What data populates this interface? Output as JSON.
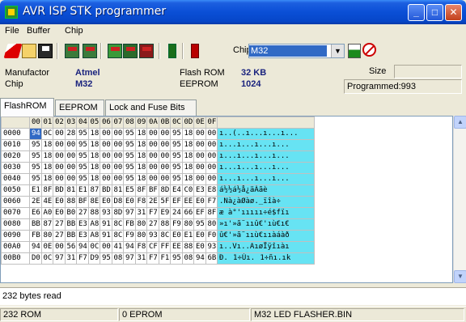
{
  "window": {
    "title": "AVR ISP STK programmer"
  },
  "menu": {
    "items": [
      "File",
      "Buffer",
      "Chip"
    ]
  },
  "toolbar": {
    "chip_label": "Chip",
    "chip_value": "M32",
    "icons": [
      "erase-icon",
      "open-icon",
      "save-icon",
      "read-chip-icon",
      "write-chip-icon",
      "verify-icon",
      "device-icon",
      "lock-icon",
      "run-icon",
      "stop-icon",
      "program-icon",
      "abort-icon"
    ]
  },
  "info": {
    "manufacturer_label": "Manufactor",
    "manufacturer_value": "Atmel",
    "chip_label": "Chip",
    "chip_value": "M32",
    "flash_label": "Flash ROM",
    "flash_value": "32 KB",
    "eeprom_label": "EEPROM",
    "eeprom_value": "1024",
    "size_label": "Size",
    "size_value": "",
    "status_text": "Programmed:993"
  },
  "tabs": [
    {
      "label": "FlashROM",
      "active": true
    },
    {
      "label": "EEPROM",
      "active": false
    },
    {
      "label": "Lock and Fuse Bits",
      "active": false
    }
  ],
  "hex": {
    "columns": [
      "00",
      "01",
      "02",
      "03",
      "04",
      "05",
      "06",
      "07",
      "08",
      "09",
      "0A",
      "0B",
      "0C",
      "0D",
      "0E",
      "0F"
    ],
    "rows": [
      {
        "addr": "0000",
        "bytes": [
          "94",
          "0C",
          "00",
          "28",
          "95",
          "18",
          "00",
          "00",
          "95",
          "18",
          "00",
          "00",
          "95",
          "18",
          "00",
          "00"
        ],
        "ascii": "ı..(..ı...ı...ı..."
      },
      {
        "addr": "0010",
        "bytes": [
          "95",
          "18",
          "00",
          "00",
          "95",
          "18",
          "00",
          "00",
          "95",
          "18",
          "00",
          "00",
          "95",
          "18",
          "00",
          "00"
        ],
        "ascii": "ı...ı...ı...ı..."
      },
      {
        "addr": "0020",
        "bytes": [
          "95",
          "18",
          "00",
          "00",
          "95",
          "18",
          "00",
          "00",
          "95",
          "18",
          "00",
          "00",
          "95",
          "18",
          "00",
          "00"
        ],
        "ascii": "ı...ı...ı...ı..."
      },
      {
        "addr": "0030",
        "bytes": [
          "95",
          "18",
          "00",
          "00",
          "95",
          "18",
          "00",
          "00",
          "95",
          "18",
          "00",
          "00",
          "95",
          "18",
          "00",
          "00"
        ],
        "ascii": "ı...ı...ı...ı..."
      },
      {
        "addr": "0040",
        "bytes": [
          "95",
          "18",
          "00",
          "00",
          "95",
          "18",
          "00",
          "00",
          "95",
          "18",
          "00",
          "00",
          "95",
          "18",
          "00",
          "00"
        ],
        "ascii": "ı...ı...ı...ı..."
      },
      {
        "addr": "0050",
        "bytes": [
          "E1",
          "8F",
          "BD",
          "81",
          "E1",
          "87",
          "BD",
          "81",
          "E5",
          "8F",
          "BF",
          "8D",
          "E4",
          "C0",
          "E3",
          "E8"
        ],
        "ascii": "á½½á½å¿äÀãè"
      },
      {
        "addr": "0060",
        "bytes": [
          "2E",
          "4E",
          "E0",
          "88",
          "BF",
          "8E",
          "E0",
          "D8",
          "E0",
          "F8",
          "2E",
          "5F",
          "EF",
          "EE",
          "E0",
          "F7"
        ],
        "ascii": ".Nà¿àØàø._ïîà÷"
      },
      {
        "addr": "0070",
        "bytes": [
          "E6",
          "A0",
          "E0",
          "B0",
          "27",
          "88",
          "93",
          "8D",
          "97",
          "31",
          "F7",
          "E9",
          "24",
          "66",
          "EF",
          "8F"
        ],
        "ascii": "æ à°'ııııı÷é$fïı"
      },
      {
        "addr": "0080",
        "bytes": [
          "BB",
          "87",
          "27",
          "BB",
          "E3",
          "A8",
          "91",
          "8C",
          "FB",
          "80",
          "27",
          "88",
          "F9",
          "80",
          "95",
          "80"
        ],
        "ascii": "»ı'»ã¨ııû€'ıù€ı€"
      },
      {
        "addr": "0090",
        "bytes": [
          "FB",
          "80",
          "27",
          "BB",
          "E3",
          "A8",
          "91",
          "8C",
          "F9",
          "80",
          "93",
          "8C",
          "E0",
          "E1",
          "E0",
          "F0"
        ],
        "ascii": "û€'»ã¨ııù€ııàáàð"
      },
      {
        "addr": "00A0",
        "bytes": [
          "94",
          "0E",
          "00",
          "56",
          "94",
          "0C",
          "00",
          "41",
          "94",
          "F8",
          "CF",
          "FF",
          "EE",
          "88",
          "E0",
          "93"
        ],
        "ascii": "ı..Vı..AıøÏÿîıàı"
      },
      {
        "addr": "00B0",
        "bytes": [
          "D0",
          "0C",
          "97",
          "31",
          "F7",
          "D9",
          "95",
          "08",
          "97",
          "31",
          "F7",
          "F1",
          "95",
          "08",
          "94",
          "6B"
        ],
        "ascii": "Ð.1÷Ùı.1÷ñı.ık"
      }
    ]
  },
  "message": "232 bytes read",
  "statusbar": [
    "232 ROM",
    "0 EPROM",
    "M32 LED FLASHER.BIN"
  ],
  "colors": {
    "title_bar": "#0a4fd6",
    "ascii_bg": "#67e3f3",
    "selection": "#316ac5",
    "value_text": "#1a237e"
  }
}
